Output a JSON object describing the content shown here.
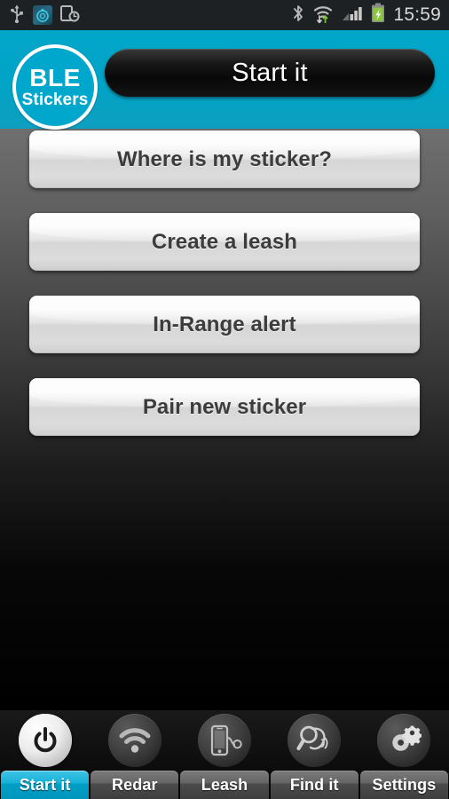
{
  "statusbar": {
    "time": "15:59",
    "left_icons": [
      {
        "name": "usb-icon",
        "glyph": "usb"
      },
      {
        "name": "app-notification-icon",
        "glyph": "app"
      },
      {
        "name": "device-clock-icon",
        "glyph": "device-clock"
      }
    ],
    "right_icons": [
      {
        "name": "bluetooth-icon",
        "glyph": "bluetooth"
      },
      {
        "name": "wifi-transfer-icon",
        "glyph": "wifi"
      },
      {
        "name": "signal-bars-icon",
        "glyph": "signal"
      },
      {
        "name": "battery-charging-icon",
        "glyph": "battery"
      }
    ],
    "battery_color": "#8cc63f",
    "bg_color": "#1e2124"
  },
  "header": {
    "title": "Start it",
    "accent_color": "#00a4c6",
    "logo": {
      "main": "BLE",
      "sub": "Stickers"
    }
  },
  "main": {
    "buttons": [
      {
        "label": "Where is my sticker?",
        "name": "where-is-my-sticker-button"
      },
      {
        "label": "Create a leash",
        "name": "create-a-leash-button"
      },
      {
        "label": "In-Range alert",
        "name": "in-range-alert-button"
      },
      {
        "label": "Pair new sticker",
        "name": "pair-new-sticker-button"
      }
    ]
  },
  "navbar": {
    "active_color": "#00a4c6",
    "items": [
      {
        "label": "Start it",
        "icon": "power-icon",
        "active": true
      },
      {
        "label": "Redar",
        "icon": "wifi-radar-icon",
        "active": false
      },
      {
        "label": "Leash",
        "icon": "phone-leash-icon",
        "active": false
      },
      {
        "label": "Find it",
        "icon": "magnifier-signal-icon",
        "active": false
      },
      {
        "label": "Settings",
        "icon": "gears-icon",
        "active": false
      }
    ]
  }
}
